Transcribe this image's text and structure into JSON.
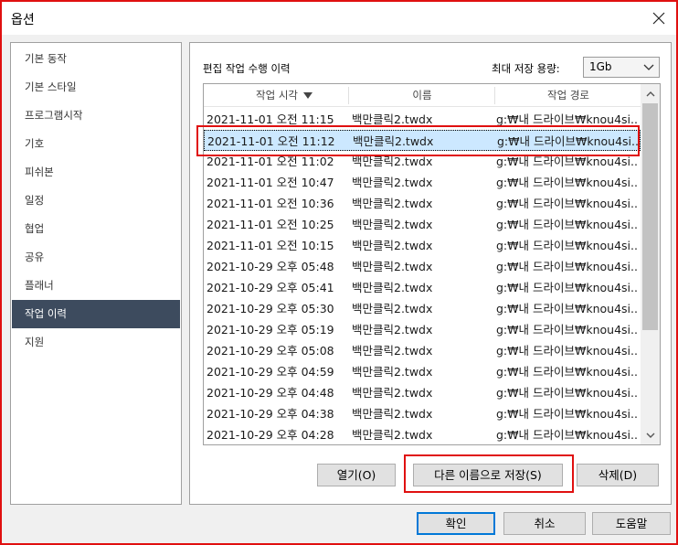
{
  "window": {
    "title": "옵션"
  },
  "sidebar": {
    "items": [
      {
        "label": "기본 동작",
        "active": false
      },
      {
        "label": "기본 스타일",
        "active": false
      },
      {
        "label": "프로그램시작",
        "active": false
      },
      {
        "label": "기호",
        "active": false
      },
      {
        "label": "피쉬본",
        "active": false
      },
      {
        "label": "일정",
        "active": false
      },
      {
        "label": "협업",
        "active": false
      },
      {
        "label": "공유",
        "active": false
      },
      {
        "label": "플래너",
        "active": false
      },
      {
        "label": "작업 이력",
        "active": true
      },
      {
        "label": "지원",
        "active": false
      }
    ]
  },
  "history": {
    "section_label": "편집 작업 수행 이력",
    "capacity_label": "최대 저장 용량:",
    "capacity_value": "1Gb",
    "columns": [
      "작업 시각",
      "이름",
      "작업 경로"
    ],
    "selected_index": 1,
    "rows": [
      [
        "2021-11-01 오전 11:15",
        "백만클릭2.twdx",
        "g:₩내 드라이브₩knou4si..."
      ],
      [
        "2021-11-01 오전 11:12",
        "백만클릭2.twdx",
        "g:₩내 드라이브₩knou4si..."
      ],
      [
        "2021-11-01 오전 11:02",
        "백만클릭2.twdx",
        "g:₩내 드라이브₩knou4si..."
      ],
      [
        "2021-11-01 오전 10:47",
        "백만클릭2.twdx",
        "g:₩내 드라이브₩knou4si..."
      ],
      [
        "2021-11-01 오전 10:36",
        "백만클릭2.twdx",
        "g:₩내 드라이브₩knou4si..."
      ],
      [
        "2021-11-01 오전 10:25",
        "백만클릭2.twdx",
        "g:₩내 드라이브₩knou4si..."
      ],
      [
        "2021-11-01 오전 10:15",
        "백만클릭2.twdx",
        "g:₩내 드라이브₩knou4si..."
      ],
      [
        "2021-10-29 오후 05:48",
        "백만클릭2.twdx",
        "g:₩내 드라이브₩knou4si..."
      ],
      [
        "2021-10-29 오후 05:41",
        "백만클릭2.twdx",
        "g:₩내 드라이브₩knou4si..."
      ],
      [
        "2021-10-29 오후 05:30",
        "백만클릭2.twdx",
        "g:₩내 드라이브₩knou4si..."
      ],
      [
        "2021-10-29 오후 05:19",
        "백만클릭2.twdx",
        "g:₩내 드라이브₩knou4si..."
      ],
      [
        "2021-10-29 오후 05:08",
        "백만클릭2.twdx",
        "g:₩내 드라이브₩knou4si..."
      ],
      [
        "2021-10-29 오후 04:59",
        "백만클릭2.twdx",
        "g:₩내 드라이브₩knou4si..."
      ],
      [
        "2021-10-29 오후 04:48",
        "백만클릭2.twdx",
        "g:₩내 드라이브₩knou4si..."
      ],
      [
        "2021-10-29 오후 04:38",
        "백만클릭2.twdx",
        "g:₩내 드라이브₩knou4si..."
      ],
      [
        "2021-10-29 오후 04:28",
        "백만클릭2.twdx",
        "g:₩내 드라이브₩knou4si..."
      ]
    ],
    "buttons": {
      "open": "열기(O)",
      "save_as": "다른 이름으로 저장(S)",
      "delete": "삭제(D)"
    }
  },
  "footer": {
    "ok": "확인",
    "cancel": "취소",
    "help": "도움말"
  },
  "icons": {
    "close": "close-icon",
    "sort": "sort-desc-icon",
    "dropdown": "chevron-down-icon",
    "scroll_up": "chevron-up-icon",
    "scroll_down": "chevron-down-icon"
  },
  "colors": {
    "annotation": "#e01010",
    "sidebar_active": "#3d4b5e",
    "selected_row": "#cce8ff",
    "default_button": "#0078d7"
  }
}
